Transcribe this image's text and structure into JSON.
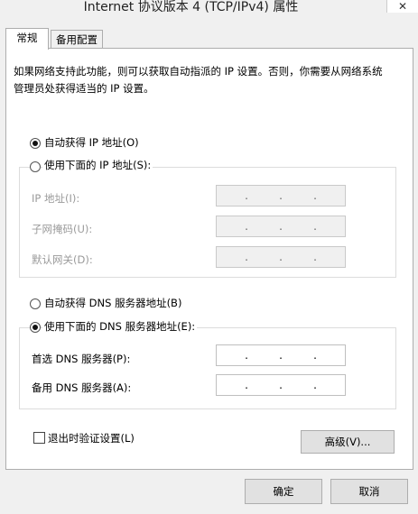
{
  "window": {
    "title": "Internet 协议版本 4 (TCP/IPv4) 属性",
    "close_icon": "close-icon"
  },
  "tabs": [
    {
      "label": "常规",
      "active": true
    },
    {
      "label": "备用配置",
      "active": false
    }
  ],
  "description": "如果网络支持此功能，则可以获取自动指派的 IP 设置。否则，你需要从网络系统管理员处获得适当的 IP 设置。",
  "ip_section": {
    "auto_label": "自动获得 IP 地址(O)",
    "manual_label": "使用下面的 IP 地址(S):",
    "selected": "auto",
    "fields": [
      {
        "label": "IP 地址(I):",
        "value": ". . ."
      },
      {
        "label": "子网掩码(U):",
        "value": ". . ."
      },
      {
        "label": "默认网关(D):",
        "value": ". . ."
      }
    ]
  },
  "dns_section": {
    "auto_label": "自动获得 DNS 服务器地址(B)",
    "manual_label": "使用下面的 DNS 服务器地址(E):",
    "selected": "manual",
    "fields": [
      {
        "label": "首选 DNS 服务器(P):",
        "value": ". . ."
      },
      {
        "label": "备用 DNS 服务器(A):",
        "value": ". . ."
      }
    ]
  },
  "validate_on_exit": {
    "label": "退出时验证设置(L)",
    "checked": false
  },
  "buttons": {
    "advanced": "高级(V)...",
    "ok": "确定",
    "cancel": "取消"
  }
}
